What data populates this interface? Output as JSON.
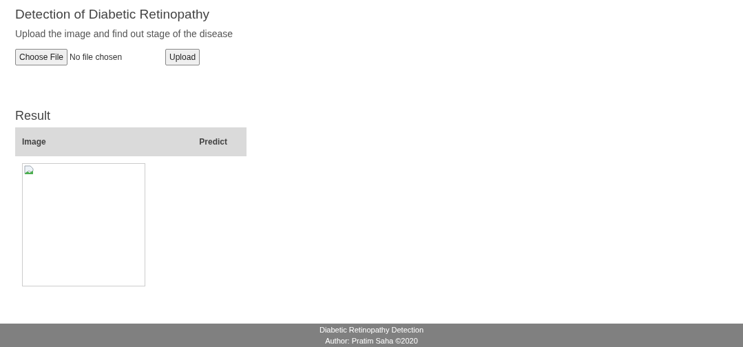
{
  "title": "Detection of Diabetic Retinopathy",
  "subtitle": "Upload the image and find out stage of the disease",
  "file_input": {
    "button": "Choose File",
    "status": "No file chosen"
  },
  "upload_button": "Upload",
  "result": {
    "heading": "Result",
    "columns": [
      "Image",
      "Predict"
    ]
  },
  "footer": {
    "lines": [
      "Diabetic Retinopathy Detection",
      "Author: Pratim Saha ©2020"
    ]
  }
}
